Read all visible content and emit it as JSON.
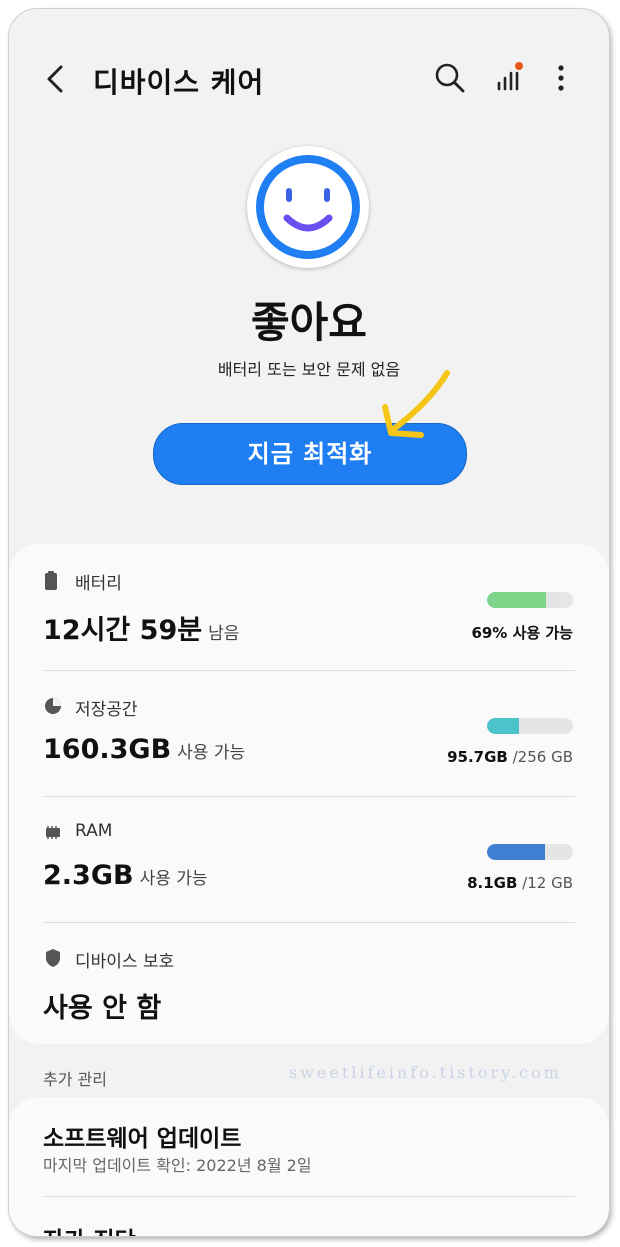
{
  "header": {
    "title": "디바이스 케어",
    "icons": [
      "back-arrow-icon",
      "search-icon",
      "signal-bars-icon",
      "more-icon"
    ],
    "notification_dot_color": "#e8581a"
  },
  "status": {
    "headline": "좋아요",
    "subtitle": "배터리 또는 보안 문제 없음",
    "face_color": "#1f7ff2",
    "smile_color": "#6c4ff0"
  },
  "optimize_button": {
    "label": "지금 최적화"
  },
  "items": [
    {
      "icon": "battery-icon",
      "label": "배터리",
      "value": "12시간 59분",
      "unit": "남음",
      "meta_bold": "69% 사용 가능",
      "meta_rest": "",
      "level": 0.69,
      "color": "#7dd68a"
    },
    {
      "icon": "storage-pie-icon",
      "label": "저장공간",
      "value": "160.3GB",
      "unit": "사용 가능",
      "meta_bold": "95.7GB",
      "meta_rest": " /256 GB",
      "level": 0.37,
      "color": "#4cc2c9"
    },
    {
      "icon": "memory-chip-icon",
      "label": "RAM",
      "value": "2.3GB",
      "unit": "사용 가능",
      "meta_bold": "8.1GB",
      "meta_rest": " /12 GB",
      "level": 0.67,
      "color": "#3f7fd1"
    },
    {
      "icon": "shield-icon",
      "label": "디바이스 보호",
      "value": "사용 안 함",
      "unit": "",
      "meta_bold": "",
      "meta_rest": ""
    }
  ],
  "more": {
    "section_title": "추가 관리",
    "watermark": "sweetlifeinfo.tistory.com",
    "software_update": {
      "title": "소프트웨어 업데이트",
      "subtitle": "마지막 업데이트 확인: 2022년 8월 2일"
    },
    "self_diagnosis": {
      "title": "자가 진단"
    }
  }
}
